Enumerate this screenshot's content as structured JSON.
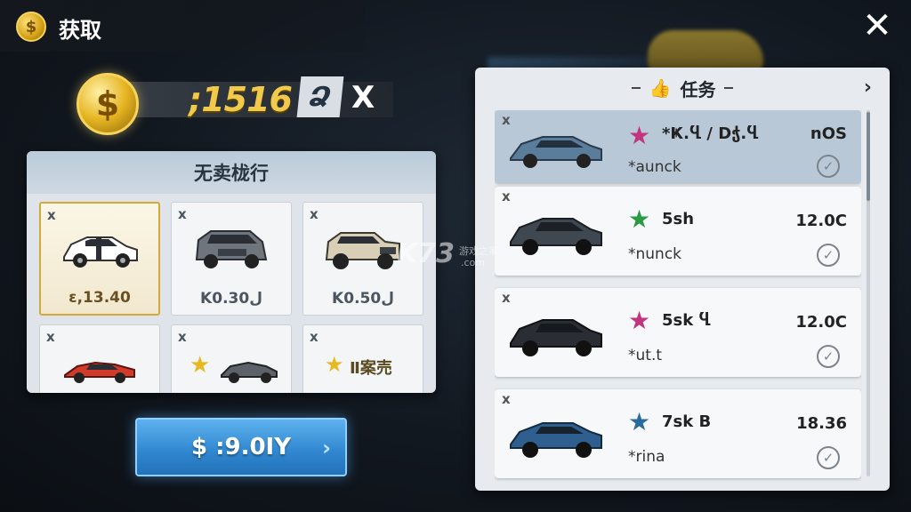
{
  "header": {
    "title": "获取",
    "coin_glyph": "$",
    "close_glyph": "✕"
  },
  "balance": {
    "coin_glyph": "$",
    "value": ";1516",
    "badge": "Ձ",
    "multiplier": "X"
  },
  "shop": {
    "title": "无卖栊行",
    "items": [
      {
        "close": "x",
        "price": "ε,13.40",
        "selected": true,
        "car_color": "#ffffff"
      },
      {
        "close": "x",
        "price": "Kل0.30",
        "selected": false,
        "car_color": "#6f757d"
      },
      {
        "close": "x",
        "price": "Kل0.50",
        "selected": false,
        "car_color": "#d8cfb6"
      },
      {
        "close": "x",
        "price": "",
        "selected": false,
        "car_color": "#d23a2a"
      },
      {
        "close": "x",
        "price": "",
        "selected": false,
        "car_color": "#5d6168",
        "star": "★"
      },
      {
        "close": "x",
        "price": "Ⅱ案売",
        "selected": false,
        "star": "★"
      }
    ]
  },
  "buy_button": {
    "label": "$ :9.0IY",
    "arrow": "›"
  },
  "tasks_panel": {
    "title": "任务",
    "icon": "👍",
    "arrow": "›",
    "tasks": [
      {
        "close": "x",
        "star": "★",
        "star_color": "#c2347f",
        "name": "*Ҝ.Ⴁ / Dჭ.Ⴁ",
        "value": "nOS",
        "sub": "*aunck",
        "check": "✓",
        "car_color": "#5b7d9c",
        "active": true
      },
      {
        "close": "x",
        "star": "★",
        "star_color": "#2a9a44",
        "name": "5sh",
        "value": "12.0C",
        "sub": "*nunck",
        "check": "✓",
        "car_color": "#3f4750",
        "active": false
      },
      {
        "close": "x",
        "star": "★",
        "star_color": "#c2347f",
        "name": "5sk Ⴁ",
        "value": "12.0C",
        "sub": "*ut.t",
        "check": "✓",
        "car_color": "#2a2e34",
        "active": false
      },
      {
        "close": "x",
        "star": "★",
        "star_color": "#2a6b9c",
        "name": "7sk B",
        "value": "18.36",
        "sub": "*rina",
        "check": "✓",
        "car_color": "#2f5f8f",
        "active": false
      }
    ]
  },
  "watermark": {
    "logo": "K73",
    "text": "游戏之家",
    "sub": ".com"
  }
}
